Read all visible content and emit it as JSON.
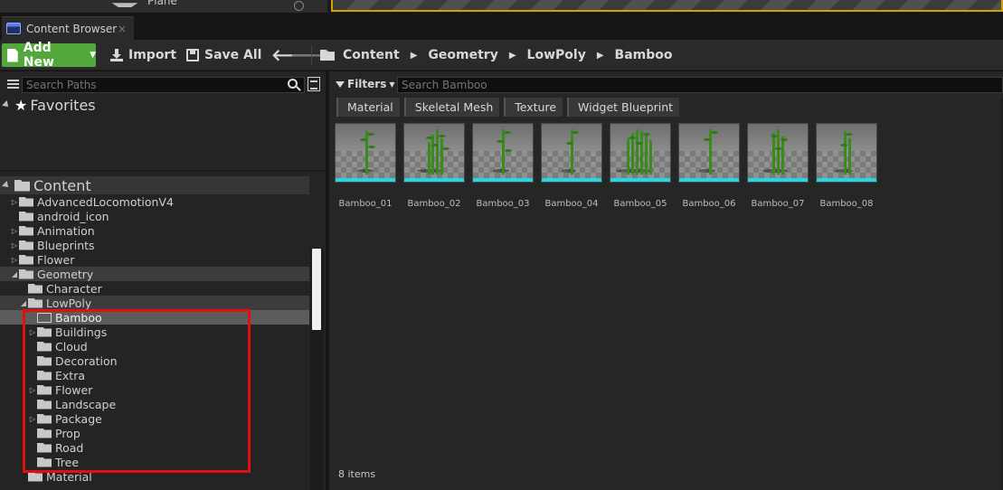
{
  "top_strip": {
    "item_label": "Plane"
  },
  "tab": {
    "title": "Content Browser",
    "close": "×"
  },
  "toolbar": {
    "add_new": "Add New",
    "import": "Import",
    "save_all": "Save All",
    "back": "🡐",
    "forward": "🡒"
  },
  "breadcrumb": [
    "Content",
    "Geometry",
    "LowPoly",
    "Bamboo"
  ],
  "path_search": {
    "placeholder": "Search Paths"
  },
  "favorites": {
    "label": "Favorites"
  },
  "tree": {
    "root": "Content",
    "items": [
      "AdvancedLocomotionV4",
      "android_icon",
      "Animation",
      "Blueprints",
      "Flower",
      "Geometry",
      "Character",
      "LowPoly",
      "Bamboo",
      "Buildings",
      "Cloud",
      "Decoration",
      "Extra",
      "Flower",
      "Landscape",
      "Package",
      "Prop",
      "Road",
      "Tree",
      "Material"
    ]
  },
  "asset_view": {
    "filters_label": "Filters",
    "search_placeholder": "Search Bamboo",
    "chips": [
      "Material",
      "Skeletal Mesh",
      "Texture",
      "Widget Blueprint"
    ],
    "assets": [
      "Bamboo_01",
      "Bamboo_02",
      "Bamboo_03",
      "Bamboo_04",
      "Bamboo_05",
      "Bamboo_06",
      "Bamboo_07",
      "Bamboo_08"
    ],
    "item_count": "8 items"
  },
  "colors": {
    "accent_green": "#52a83a",
    "selection_box": "#e01010",
    "asset_bar": "#23d8e6",
    "viewport_border": "#d4a200"
  }
}
